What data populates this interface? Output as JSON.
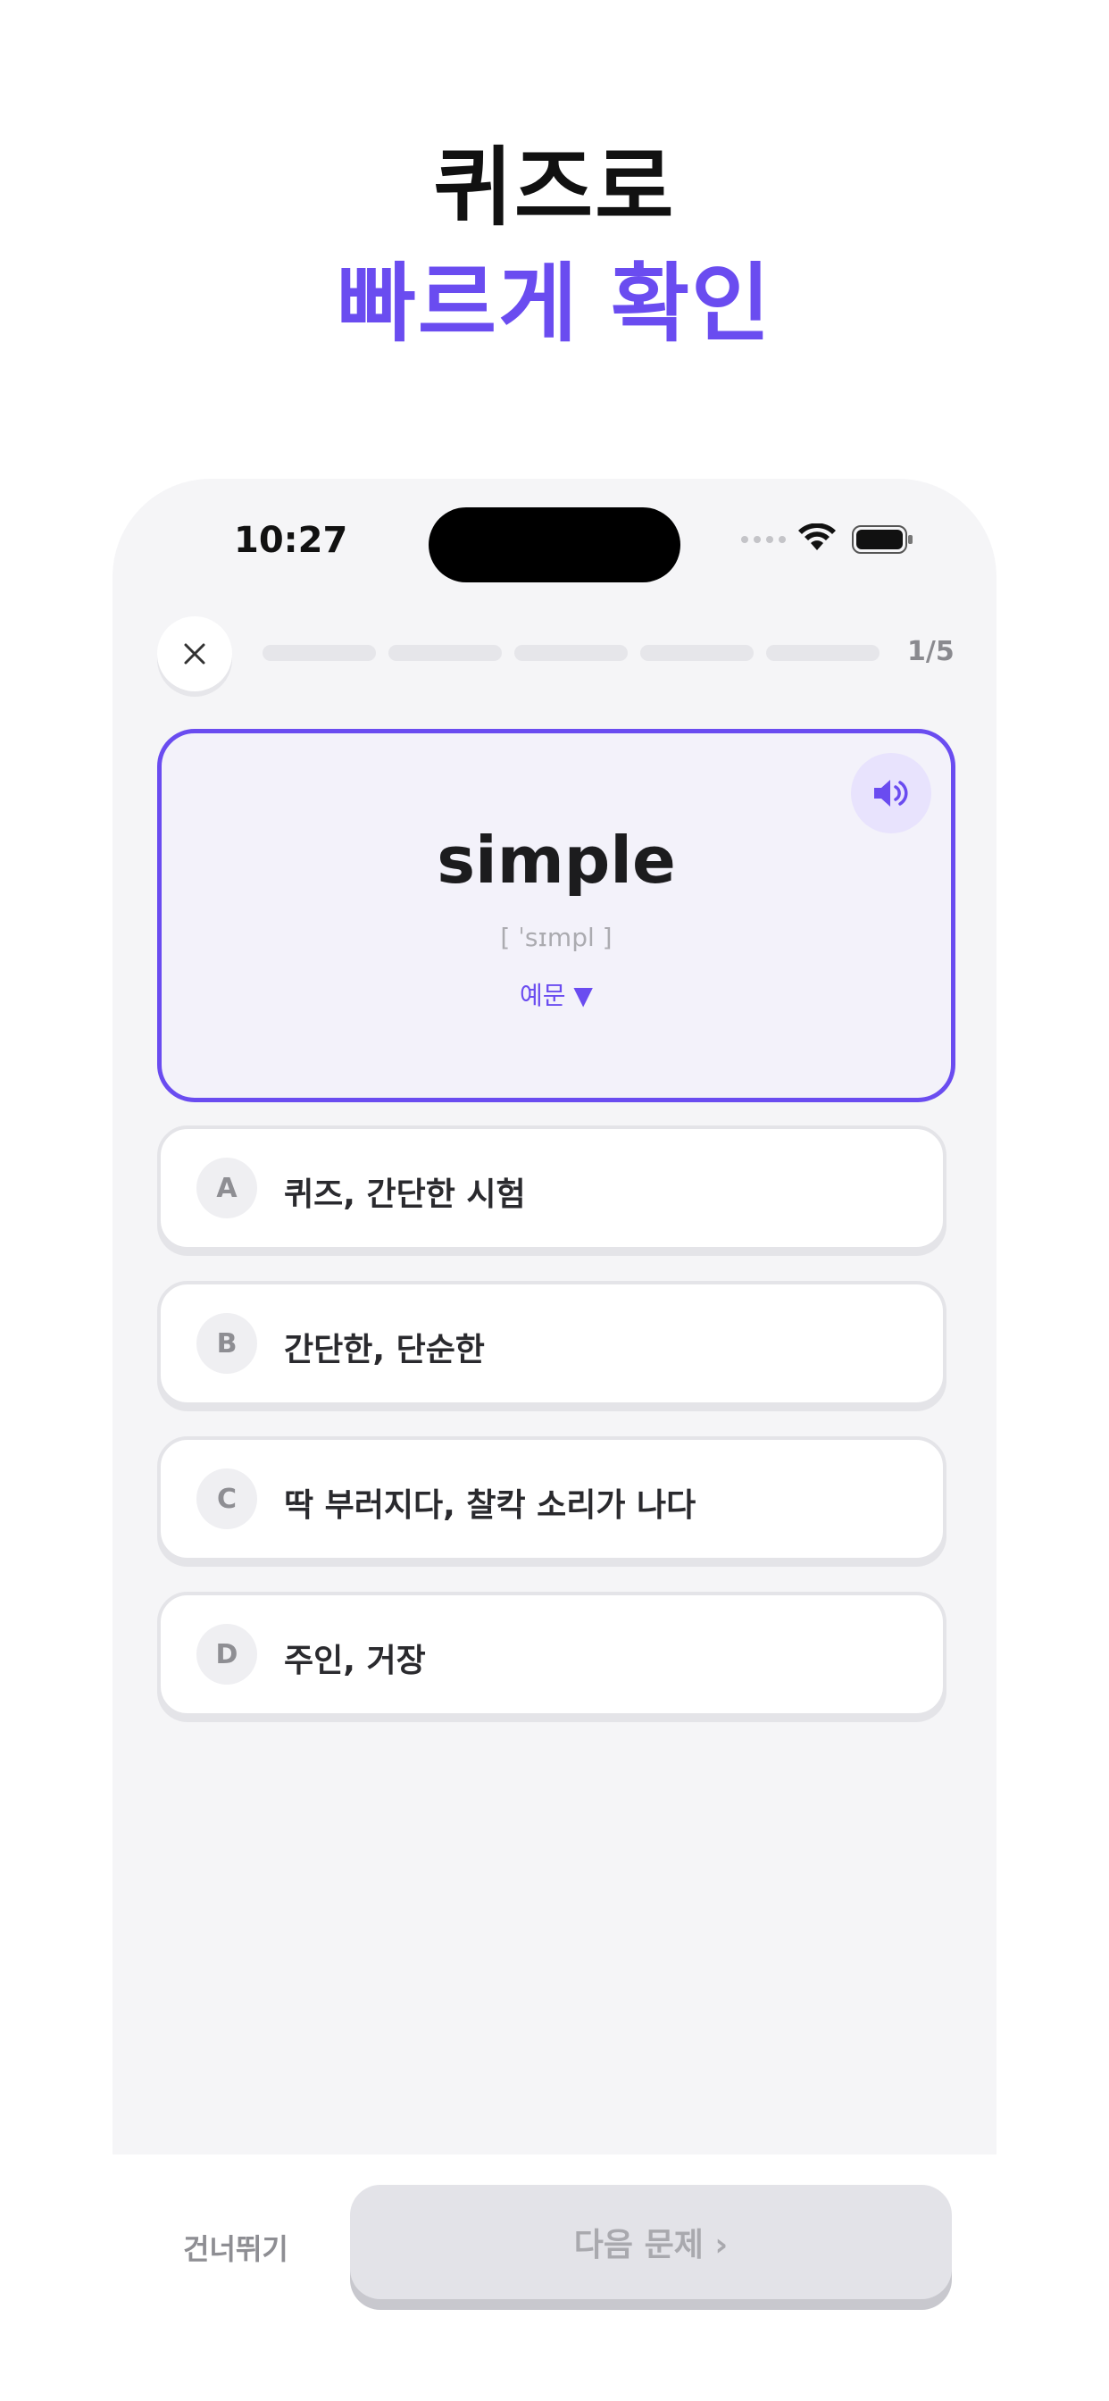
{
  "headline": {
    "line1": "퀴즈로",
    "line2": "빠르게 확인"
  },
  "status_bar": {
    "time": "10:27"
  },
  "quiz": {
    "counter": "1/5",
    "progress_current": 0,
    "progress_total": 5,
    "word": "simple",
    "phonetic": "[ ˈsɪmpl ]",
    "example_toggle": "예문 ▼",
    "options": [
      {
        "letter": "A",
        "text": "퀴즈, 간단한 시험"
      },
      {
        "letter": "B",
        "text": "간단한, 단순한"
      },
      {
        "letter": "C",
        "text": "딱 부러지다, 찰칵 소리가 나다"
      },
      {
        "letter": "D",
        "text": "주인, 거장"
      }
    ]
  },
  "footer": {
    "skip_label": "건너뛰기",
    "next_label": "다음 문제 ›"
  },
  "colors": {
    "accent": "#6a4cf0",
    "card_bg": "#f3f2fa",
    "phone_bg": "#f5f5f7"
  }
}
